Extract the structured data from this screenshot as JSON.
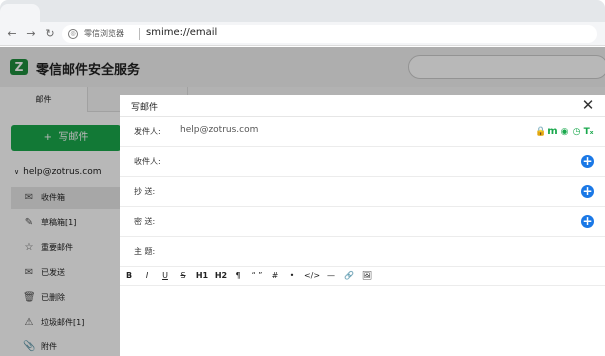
{
  "browser": {
    "site_name": "零信浏览器",
    "url": "smime://email",
    "back_icon": "arrow-left-icon",
    "forward_icon": "arrow-right-icon",
    "reload_icon": "reload-icon"
  },
  "app": {
    "logo_letter": "Z",
    "title": "零信邮件安全服务",
    "tabs": [
      "邮件"
    ],
    "compose_label": "写邮件",
    "account": "help@zotrus.com",
    "folders": [
      {
        "label": "收件箱",
        "icon": "inbox-icon"
      },
      {
        "label": "草稿箱[1]",
        "icon": "draft-icon"
      },
      {
        "label": "重要邮件",
        "icon": "star-icon"
      },
      {
        "label": "已发送",
        "icon": "sent-icon"
      },
      {
        "label": "已删除",
        "icon": "trash-icon"
      },
      {
        "label": "垃圾邮件[1]",
        "icon": "spam-icon"
      },
      {
        "label": "附件",
        "icon": "paperclip-icon"
      }
    ]
  },
  "compose": {
    "title": "写邮件",
    "sender_label": "发件人:",
    "sender_value": "help@zotrus.com",
    "to_label": "收件人:",
    "cc_label": "抄  送:",
    "bcc_label": "密  送:",
    "subject_label": "主  题:",
    "security_icons": [
      "lock-icon",
      "mime-icon",
      "certificate-icon",
      "clock-icon",
      "timestamp-icon"
    ],
    "toolbar": [
      "B",
      "I",
      "U",
      "S",
      "H1",
      "H2",
      "¶",
      "“ ”",
      "#",
      "•",
      "</>",
      "—",
      "link-icon",
      "image-icon"
    ]
  },
  "colors": {
    "brand_green": "#19a84c",
    "add_blue": "#1a78e6"
  }
}
